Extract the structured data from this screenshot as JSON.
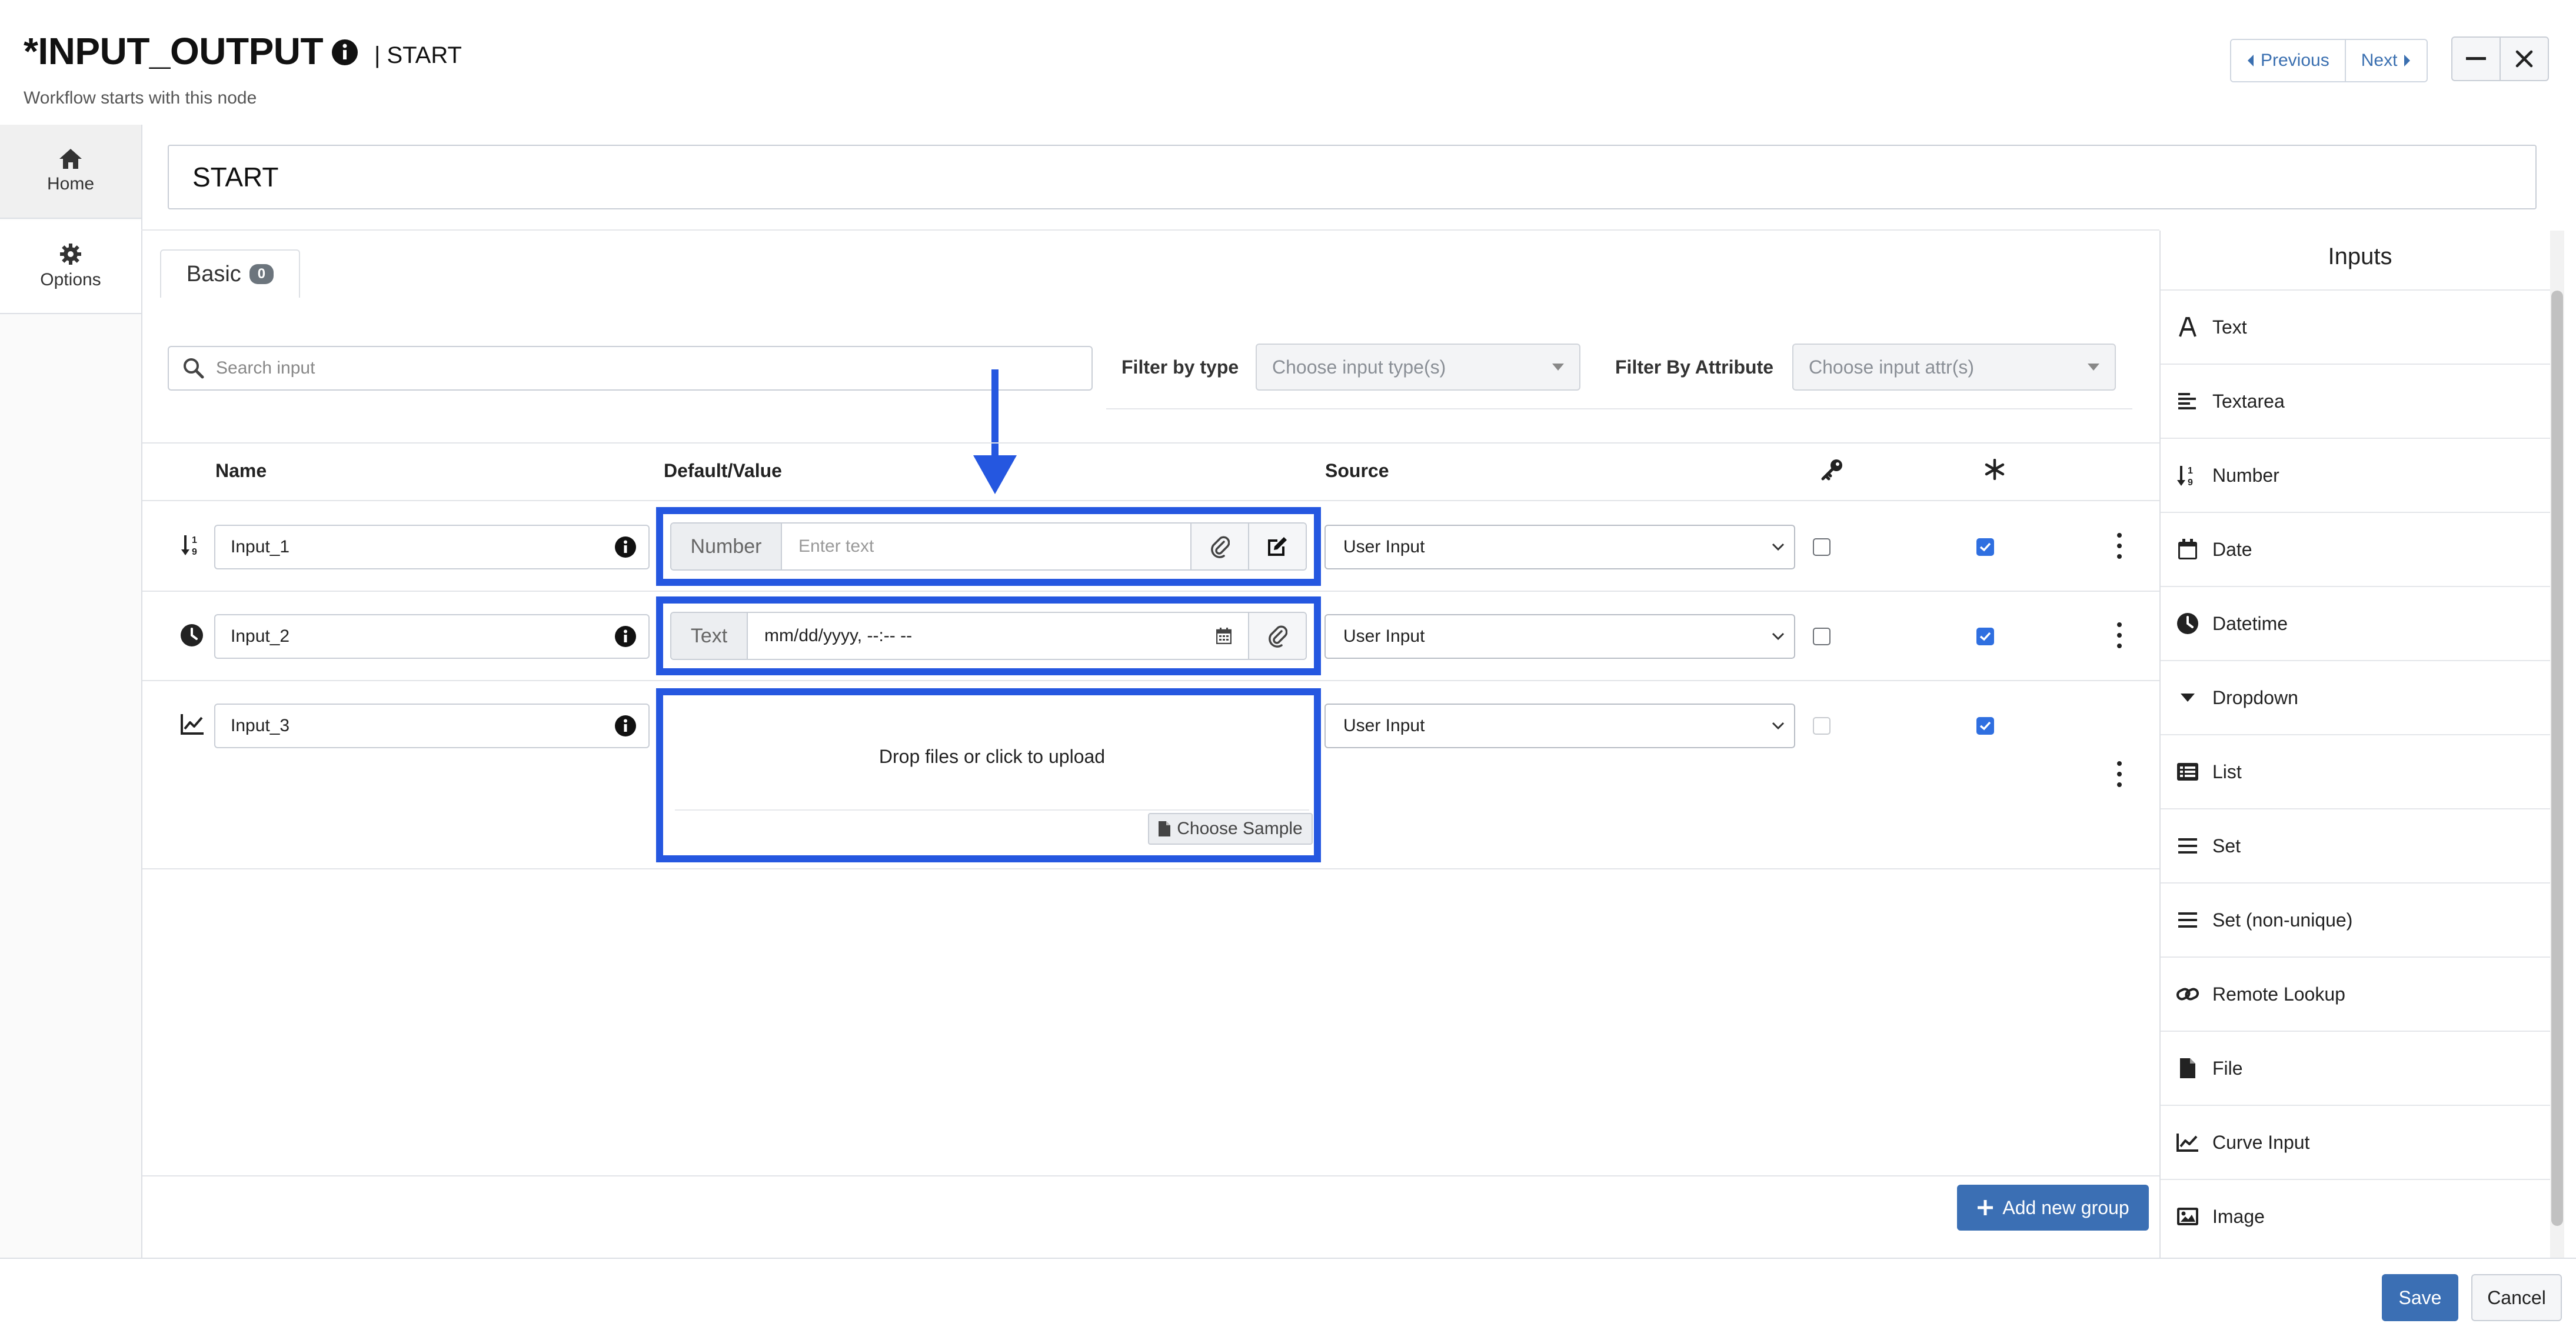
{
  "header": {
    "title": "*INPUT_OUTPUT",
    "node_label": "| START",
    "subtitle": "Workflow starts with this node",
    "previous_label": "Previous",
    "next_label": "Next"
  },
  "left_nav": [
    {
      "label": "Home",
      "icon": "home-icon"
    },
    {
      "label": "Options",
      "icon": "gear-icon"
    }
  ],
  "node_name": "START",
  "tabs": [
    {
      "label": "Basic",
      "count": "0"
    }
  ],
  "search": {
    "placeholder": "Search input"
  },
  "filters": {
    "type_label": "Filter by type",
    "type_placeholder": "Choose input type(s)",
    "attr_label": "Filter By Attribute",
    "attr_placeholder": "Choose input attr(s)"
  },
  "table": {
    "headers": {
      "name": "Name",
      "value": "Default/Value",
      "source": "Source"
    },
    "header_icons": [
      "key-icon",
      "asterisk-icon"
    ],
    "rows": [
      {
        "type_icon": "number-sort-icon",
        "name": "Input_1",
        "type_label": "Number",
        "value_placeholder": "Enter text",
        "source": "User Input",
        "key_checked": false,
        "required_checked": true
      },
      {
        "type_icon": "clock-icon",
        "name": "Input_2",
        "type_label": "Text",
        "value": "mm/dd/yyyy, --:-- --",
        "source": "User Input",
        "key_checked": false,
        "required_checked": true
      },
      {
        "type_icon": "chart-line-icon",
        "name": "Input_3",
        "drop_text": "Drop files or click to upload",
        "choose_sample_label": "Choose Sample",
        "source": "User Input",
        "key_checked": false,
        "key_disabled": true,
        "required_checked": true
      }
    ]
  },
  "inputs_panel": {
    "title": "Inputs",
    "items": [
      {
        "label": "Text",
        "icon": "font-icon"
      },
      {
        "label": "Textarea",
        "icon": "align-left-icon"
      },
      {
        "label": "Number",
        "icon": "number-sort-icon"
      },
      {
        "label": "Date",
        "icon": "calendar-icon"
      },
      {
        "label": "Datetime",
        "icon": "clock-icon"
      },
      {
        "label": "Dropdown",
        "icon": "caret-down-icon"
      },
      {
        "label": "List",
        "icon": "list-icon"
      },
      {
        "label": "Set",
        "icon": "bars-icon"
      },
      {
        "label": "Set (non-unique)",
        "icon": "bars-icon"
      },
      {
        "label": "Remote Lookup",
        "icon": "link-icon"
      },
      {
        "label": "File",
        "icon": "file-icon"
      },
      {
        "label": "Curve Input",
        "icon": "chart-line-icon"
      },
      {
        "label": "Image",
        "icon": "image-icon"
      }
    ]
  },
  "buttons": {
    "add_group": "Add new group",
    "save": "Save",
    "cancel": "Cancel"
  },
  "colors": {
    "highlight": "#2557e0",
    "primary": "#3b6fb4",
    "link": "#3a6fb0",
    "checkbox": "#2f6fe0"
  }
}
